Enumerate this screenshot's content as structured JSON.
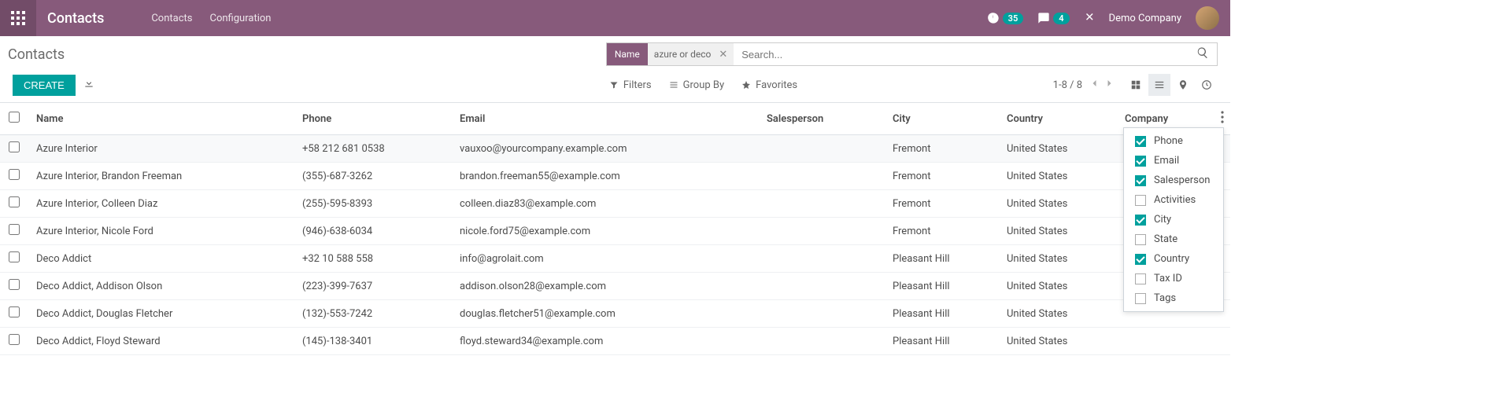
{
  "navbar": {
    "app_title": "Contacts",
    "links": [
      "Contacts",
      "Configuration"
    ],
    "activities_count": "35",
    "messages_count": "4",
    "company": "Demo Company"
  },
  "breadcrumb": "Contacts",
  "search": {
    "facet_label": "Name",
    "facet_value": "azure or deco",
    "placeholder": "Search..."
  },
  "buttons": {
    "create": "CREATE"
  },
  "search_options": {
    "filters": "Filters",
    "group_by": "Group By",
    "favorites": "Favorites"
  },
  "pager": "1-8 / 8",
  "columns": {
    "name": "Name",
    "phone": "Phone",
    "email": "Email",
    "salesperson": "Salesperson",
    "city": "City",
    "country": "Country",
    "company": "Company"
  },
  "rows": [
    {
      "name": "Azure Interior",
      "phone": "+58 212 681 0538",
      "email": "vauxoo@yourcompany.example.com",
      "salesperson": "",
      "city": "Fremont",
      "country": "United States",
      "company": ""
    },
    {
      "name": "Azure Interior, Brandon Freeman",
      "phone": "(355)-687-3262",
      "email": "brandon.freeman55@example.com",
      "salesperson": "",
      "city": "Fremont",
      "country": "United States",
      "company": ""
    },
    {
      "name": "Azure Interior, Colleen Diaz",
      "phone": "(255)-595-8393",
      "email": "colleen.diaz83@example.com",
      "salesperson": "",
      "city": "Fremont",
      "country": "United States",
      "company": ""
    },
    {
      "name": "Azure Interior, Nicole Ford",
      "phone": "(946)-638-6034",
      "email": "nicole.ford75@example.com",
      "salesperson": "",
      "city": "Fremont",
      "country": "United States",
      "company": ""
    },
    {
      "name": "Deco Addict",
      "phone": "+32 10 588 558",
      "email": "info@agrolait.com",
      "salesperson": "",
      "city": "Pleasant Hill",
      "country": "United States",
      "company": ""
    },
    {
      "name": "Deco Addict, Addison Olson",
      "phone": "(223)-399-7637",
      "email": "addison.olson28@example.com",
      "salesperson": "",
      "city": "Pleasant Hill",
      "country": "United States",
      "company": ""
    },
    {
      "name": "Deco Addict, Douglas Fletcher",
      "phone": "(132)-553-7242",
      "email": "douglas.fletcher51@example.com",
      "salesperson": "",
      "city": "Pleasant Hill",
      "country": "United States",
      "company": ""
    },
    {
      "name": "Deco Addict, Floyd Steward",
      "phone": "(145)-138-3401",
      "email": "floyd.steward34@example.com",
      "salesperson": "",
      "city": "Pleasant Hill",
      "country": "United States",
      "company": ""
    }
  ],
  "optional_columns": [
    {
      "label": "Phone",
      "checked": true
    },
    {
      "label": "Email",
      "checked": true
    },
    {
      "label": "Salesperson",
      "checked": true
    },
    {
      "label": "Activities",
      "checked": false
    },
    {
      "label": "City",
      "checked": true
    },
    {
      "label": "State",
      "checked": false
    },
    {
      "label": "Country",
      "checked": true
    },
    {
      "label": "Tax ID",
      "checked": false
    },
    {
      "label": "Tags",
      "checked": false
    }
  ]
}
